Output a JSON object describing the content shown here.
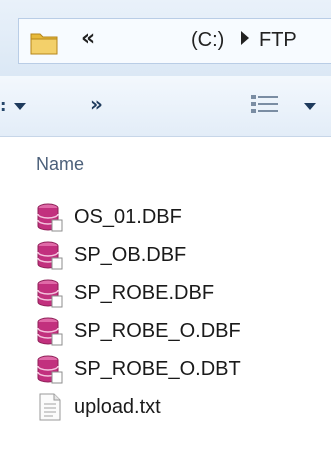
{
  "address_bar": {
    "overflow_chevron": "«",
    "drive_label": "(C:)",
    "separator": "▸",
    "current_folder": "FTP",
    "folder_icon": "folder-icon"
  },
  "toolbar": {
    "more_chevron": "»",
    "view_icon": "details-view-icon"
  },
  "column_header": {
    "name": "Name"
  },
  "files": [
    {
      "name": "OS_01.DBF",
      "icon": "database-icon"
    },
    {
      "name": "SP_OB.DBF",
      "icon": "database-icon"
    },
    {
      "name": "SP_ROBE.DBF",
      "icon": "database-icon"
    },
    {
      "name": "SP_ROBE_O.DBF",
      "icon": "database-icon"
    },
    {
      "name": "SP_ROBE_O.DBT",
      "icon": "database-icon"
    },
    {
      "name": "upload.txt",
      "icon": "text-file-icon"
    }
  ],
  "colors": {
    "database_icon": "#c2307e",
    "folder_icon": "#e7b93a"
  }
}
